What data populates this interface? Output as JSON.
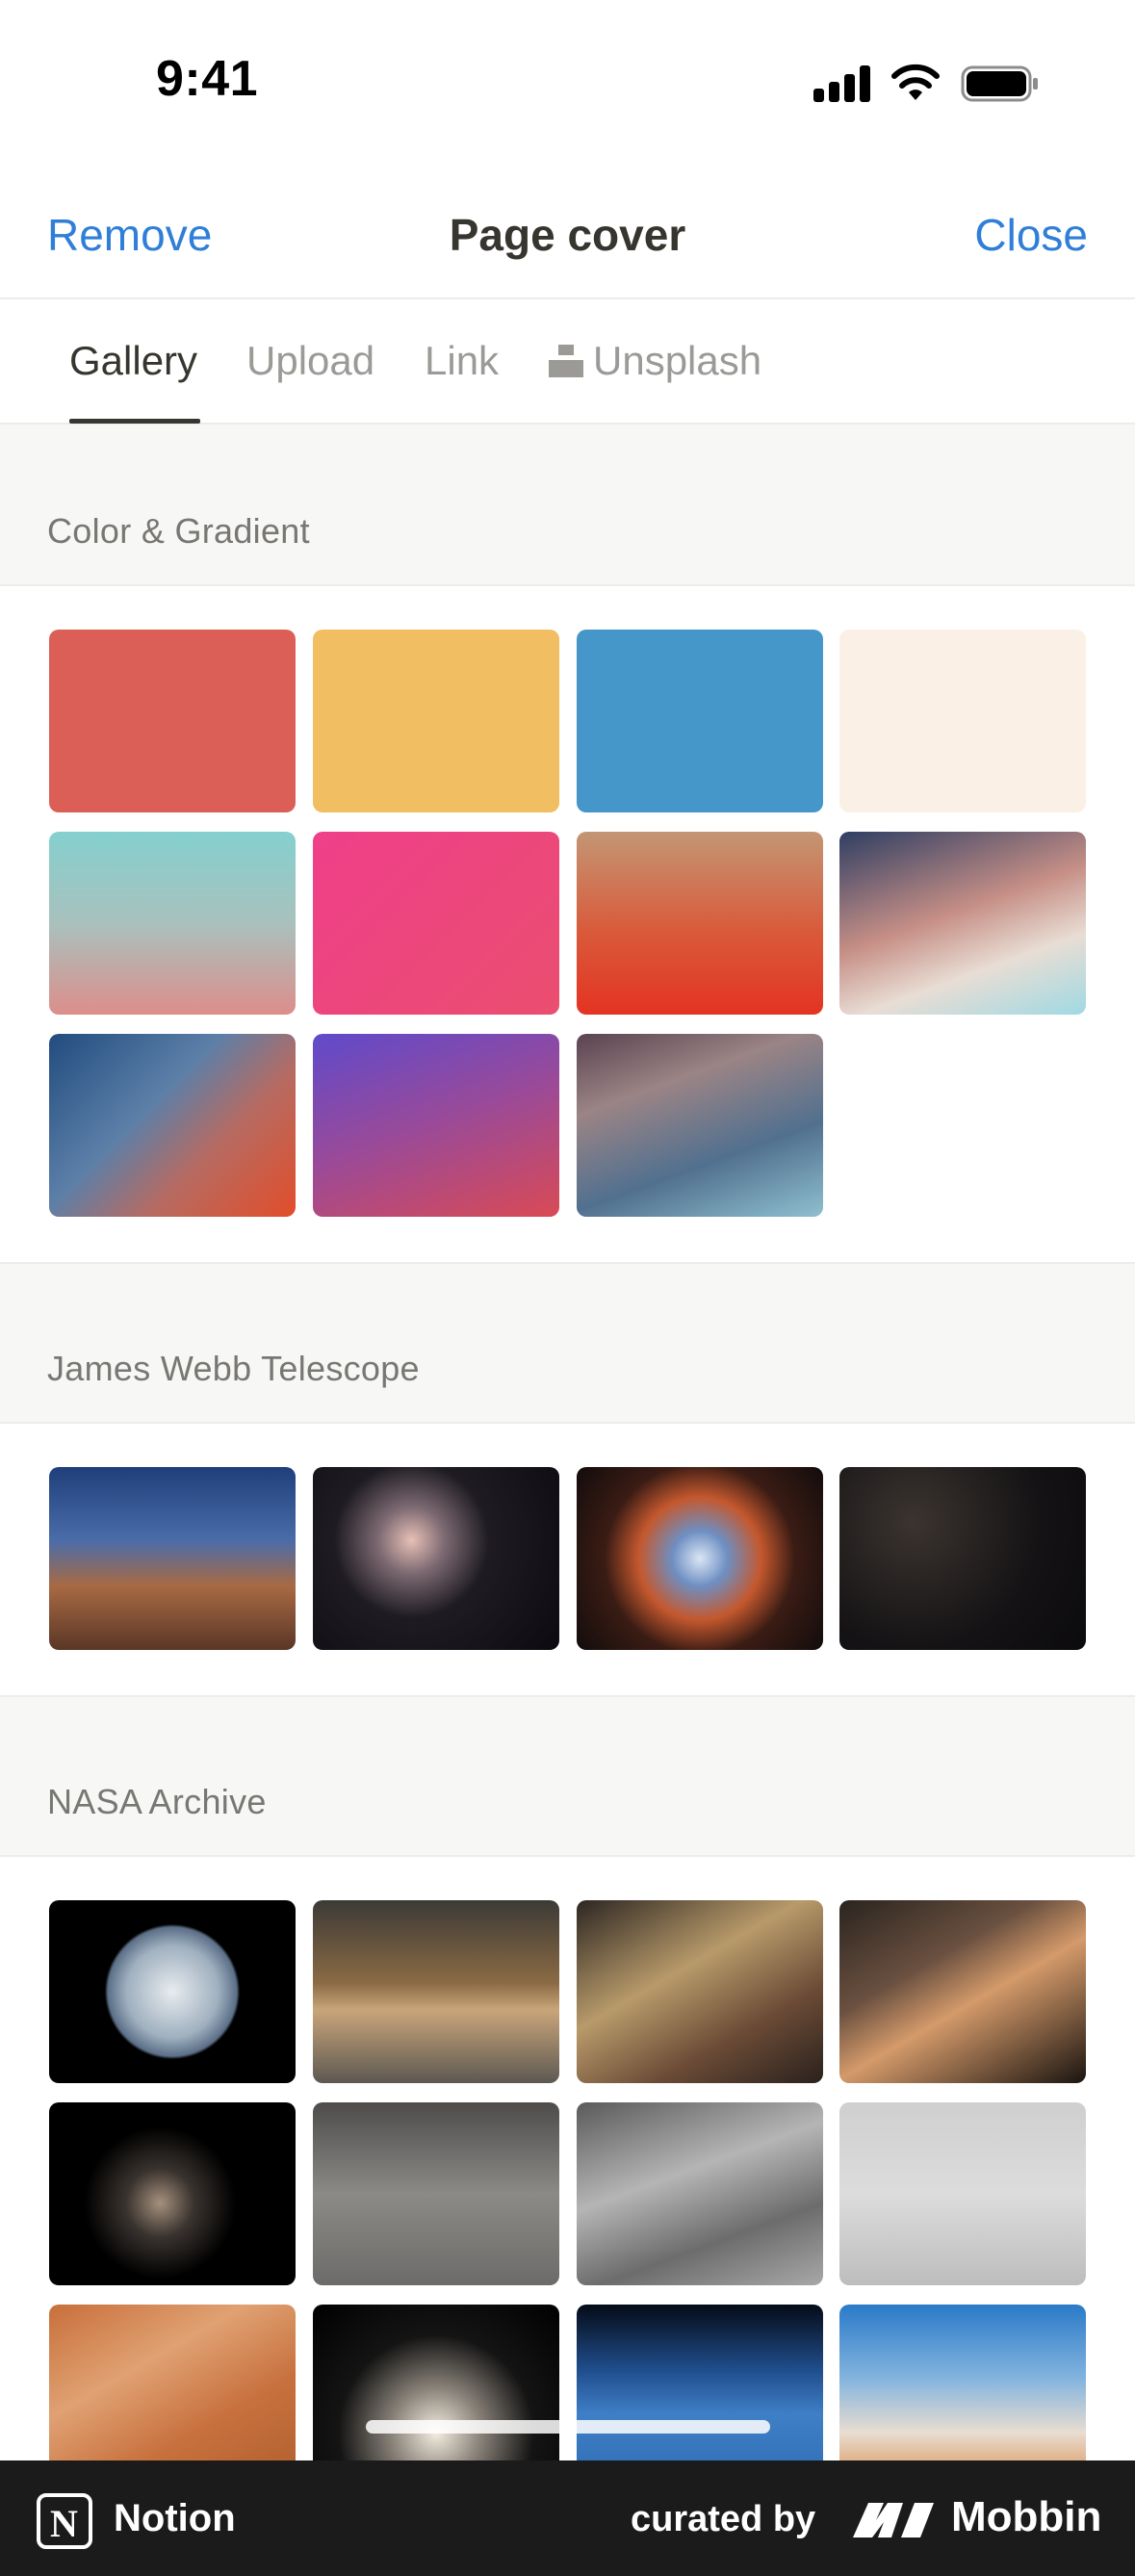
{
  "status_bar": {
    "time": "9:41"
  },
  "nav": {
    "left_label": "Remove",
    "title": "Page cover",
    "right_label": "Close"
  },
  "tabs": [
    {
      "label": "Gallery",
      "active": true
    },
    {
      "label": "Upload",
      "active": false
    },
    {
      "label": "Link",
      "active": false
    },
    {
      "label": "Unsplash",
      "active": false,
      "icon": "unsplash-icon"
    }
  ],
  "sections": [
    {
      "title": "Color & Gradient",
      "items": [
        {
          "name": "solid-red",
          "style": "#dc5f57"
        },
        {
          "name": "solid-yellow",
          "style": "#f1be62"
        },
        {
          "name": "solid-blue",
          "style": "#4596c9"
        },
        {
          "name": "solid-cream",
          "style": "#fbf0e5"
        },
        {
          "name": "gradient-teal-rose",
          "style": "linear-gradient(180deg,#84d0cf 0%,#a9c1bd 50%,#dc8e8b 100%)"
        },
        {
          "name": "gradient-pink",
          "style": "linear-gradient(135deg,#ef3f8a 0%,#ea4e6f 100%)"
        },
        {
          "name": "gradient-tan-red",
          "style": "linear-gradient(180deg,#c39674 0%,#d95a3a 55%,#e43323 100%)"
        },
        {
          "name": "gradient-navy-sky",
          "style": "linear-gradient(160deg,#2f3e63 0%,#c68f86 45%,#e8ddd4 70%,#9fd9e3 100%)"
        },
        {
          "name": "gradient-blue-red",
          "style": "linear-gradient(135deg,#214c7e 0%,#5c7fa8 40%,#b66b62 65%,#e24d2a 100%)"
        },
        {
          "name": "gradient-violet-red",
          "style": "linear-gradient(160deg,#5f4acb 0%,#9b4a97 50%,#d94a55 100%)"
        },
        {
          "name": "gradient-mauve-teal",
          "style": "linear-gradient(160deg,#5a4250 0%,#9b8485 30%,#51708f 65%,#8fc0cf 100%)"
        }
      ]
    },
    {
      "title": "James Webb Telescope",
      "items": [
        {
          "name": "carina-nebula",
          "style": "linear-gradient(180deg,#1e3f7a 0%,#4a6ca8 40%,#a86a44 65%,#5a3626 100%)"
        },
        {
          "name": "stephans-quintet",
          "style": "radial-gradient(circle at 40% 40%,#e7c0b6 0%,#7d6a72 18%,#1e1b22 42%,#0c0a10 100%)"
        },
        {
          "name": "southern-ring-nebula",
          "style": "radial-gradient(circle at 50% 50%,#dbe6f5 0%,#6e8fc2 18%,#c4582e 40%,#3a1c14 62%,#120c0c 100%)"
        },
        {
          "name": "deep-field",
          "style": "radial-gradient(circle at 30% 30%,#3b3430 0%,#141214 60%,#0b0a0c 100%)"
        }
      ]
    },
    {
      "title": "NASA Archive",
      "items": [
        {
          "name": "blue-marble-earth",
          "style": "radial-gradient(circle at 50% 50%,#e8ecef 0%,#9fb0bf 30%,#5b6f88 42%,#000000 44%,#000000 100%)"
        },
        {
          "name": "wind-tunnel",
          "style": "linear-gradient(180deg,#3c3a36 0%,#8a6a44 45%,#c9a57a 60%,#5d5852 100%)"
        },
        {
          "name": "telescope-mirror",
          "style": "linear-gradient(150deg,#2c2622 0%,#b89a6a 40%,#6b4b36 70%,#2a211d 100%)"
        },
        {
          "name": "spacewalk",
          "style": "linear-gradient(150deg,#2a241f 0%,#6a5040 35%,#d49a6a 55%,#1a1410 100%)"
        },
        {
          "name": "lunar-module",
          "style": "radial-gradient(circle at 45% 55%,#a6907c 0%,#3a3430 20%,#000000 45%,#000000 100%)"
        },
        {
          "name": "moon-surface",
          "style": "linear-gradient(180deg,#4d4c4b 0%,#8c8a87 50%,#6d6b69 100%)"
        },
        {
          "name": "computer-room",
          "style": "linear-gradient(160deg,#5a5a5a 0%,#b5b5b5 40%,#6c6c6c 70%,#a8a8a8 100%)"
        },
        {
          "name": "wright-flyer",
          "style": "linear-gradient(180deg,#cfcfcf 0%,#dcdcdc 50%,#bdbdbd 100%)"
        },
        {
          "name": "desert-terrain",
          "style": "linear-gradient(150deg,#c86f3a 0%,#e0a173 35%,#c8713e 65%,#b05e2e 100%)"
        },
        {
          "name": "launch-clouds",
          "style": "radial-gradient(circle at 50% 70%,#f4ede0 0%,#8a837a 25%,#141414 55%,#000000 100%)"
        },
        {
          "name": "earth-orbit",
          "style": "linear-gradient(180deg,#050b16 0%,#1f4c8a 35%,#3f7fc6 60%,#2f6db3 100%)"
        },
        {
          "name": "shuttle-launch",
          "style": "linear-gradient(180deg,#2a7ac8 0%,#82b3de 40%,#e8ddd0 70%,#d98a48 100%)"
        }
      ]
    }
  ],
  "footer": {
    "app_name": "Notion",
    "curated_label": "curated by",
    "brand": "Mobbin"
  }
}
